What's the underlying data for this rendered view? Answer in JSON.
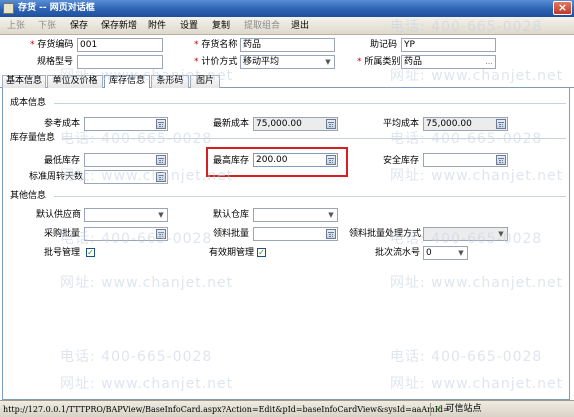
{
  "window": {
    "title": "存货 -- 网页对话框",
    "close": "×"
  },
  "toolbar": {
    "prev": "上张",
    "next": "下张",
    "save": "保存",
    "save_new": "保存新增",
    "attachment": "附件",
    "settings": "设置",
    "copy": "复制",
    "extract": "提取组合",
    "exit": "退出"
  },
  "form": {
    "code_label": "存货编码",
    "code_value": "001",
    "name_label": "存货名称",
    "name_value": "药品",
    "mnemonic_label": "助记码",
    "mnemonic_value": "YP",
    "spec_label": "规格型号",
    "spec_value": "",
    "valuation_label": "计价方式",
    "valuation_value": "移动平均",
    "category_label": "所属类别",
    "category_value": "药品"
  },
  "tabs": [
    "基本信息",
    "单位及价格",
    "库存信息",
    "条形码",
    "图片"
  ],
  "stock": {
    "cost_section": "成本信息",
    "ref_cost_label": "参考成本",
    "ref_cost_value": "",
    "latest_cost_label": "最新成本",
    "latest_cost_value": "75,000.00",
    "avg_cost_label": "平均成本",
    "avg_cost_value": "75,000.00",
    "qty_section": "库存量信息",
    "min_label": "最低库存",
    "min_value": "",
    "max_label": "最高库存",
    "max_value": "200.00",
    "safety_label": "安全库存",
    "safety_value": "",
    "turnover_label": "标准周转天数",
    "turnover_value": "",
    "other_section": "其他信息",
    "supplier_label": "默认供应商",
    "supplier_value": "",
    "warehouse_label": "默认仓库",
    "warehouse_value": "",
    "purchase_batch_label": "采购批量",
    "purchase_batch_value": "",
    "pick_batch_label": "领料批量",
    "pick_batch_value": "",
    "pick_method_label": "领料批量处理方式",
    "pick_method_value": "",
    "batch_mgmt_label": "批号管理",
    "batch_mgmt_checked": "✓",
    "expiry_mgmt_label": "有效期管理",
    "expiry_mgmt_checked": "✓",
    "serial_label": "批次流水号",
    "serial_value": "0"
  },
  "watermarks": {
    "phone": "电话: 400-665-0028",
    "site": "网址: www.chanjet.net"
  },
  "status": {
    "url": "http://127.0.0.1/TTTPRO/BAPView/BaseInfoCard.aspx?Action=Edit&pId=baseInfoCardView&sysId=aaAmId=",
    "zone": "可信站点"
  },
  "colors": {
    "highlight": "#d42020",
    "title_bg": "#2f65b5"
  }
}
